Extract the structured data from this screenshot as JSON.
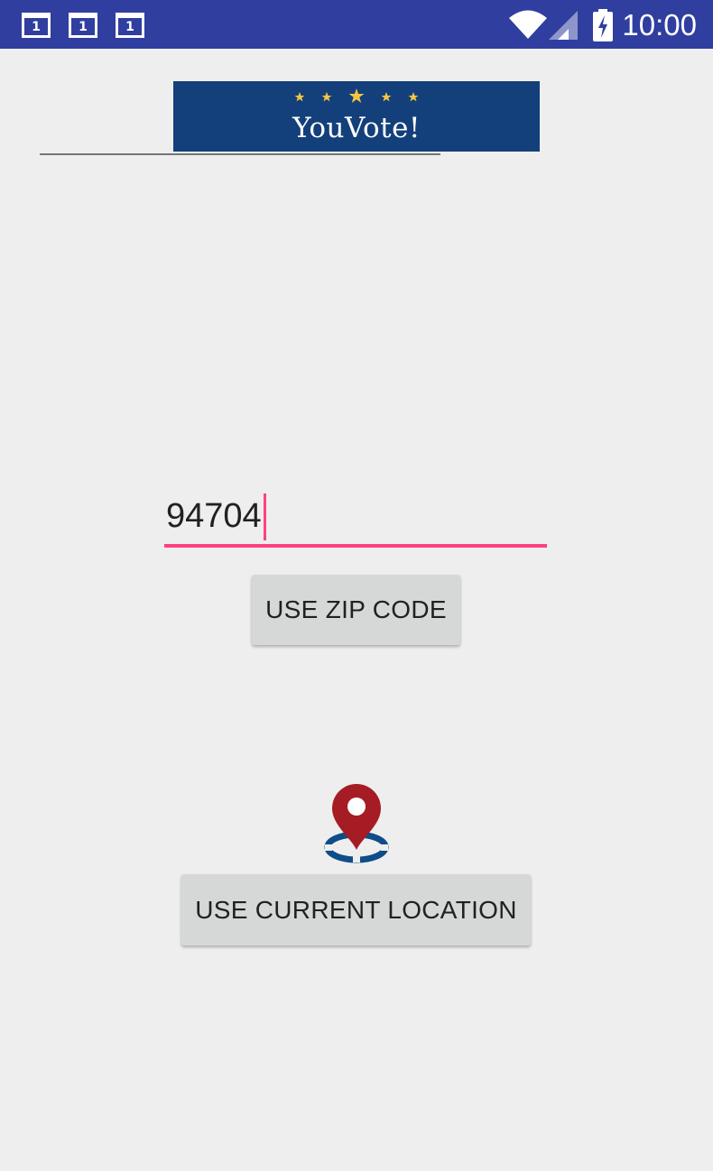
{
  "status_bar": {
    "notifications": [
      {
        "icon": "calendar-notification-icon",
        "text": "1"
      },
      {
        "icon": "calendar-notification-icon",
        "text": "1"
      },
      {
        "icon": "calendar-notification-icon",
        "text": "1"
      }
    ],
    "wifi_icon": "wifi-icon",
    "signal_icon": "cell-signal-icon",
    "battery_icon": "battery-charging-icon",
    "time": "10:00"
  },
  "logo": {
    "text": "YouVote!",
    "background_color": "#133f7a",
    "star_color": "#f5c542"
  },
  "zip_input": {
    "value": "94704",
    "accent_color": "#ff4081"
  },
  "buttons": {
    "use_zip_code": "USE ZIP CODE",
    "use_current_location": "USE CURRENT LOCATION"
  },
  "location_icon": {
    "icon": "location-pin-icon",
    "pin_color": "#a51c24",
    "ring_color": "#0e4c8a"
  },
  "colors": {
    "status_bar": "#303f9f",
    "background": "#eeeeee",
    "button": "#d6d7d7"
  }
}
